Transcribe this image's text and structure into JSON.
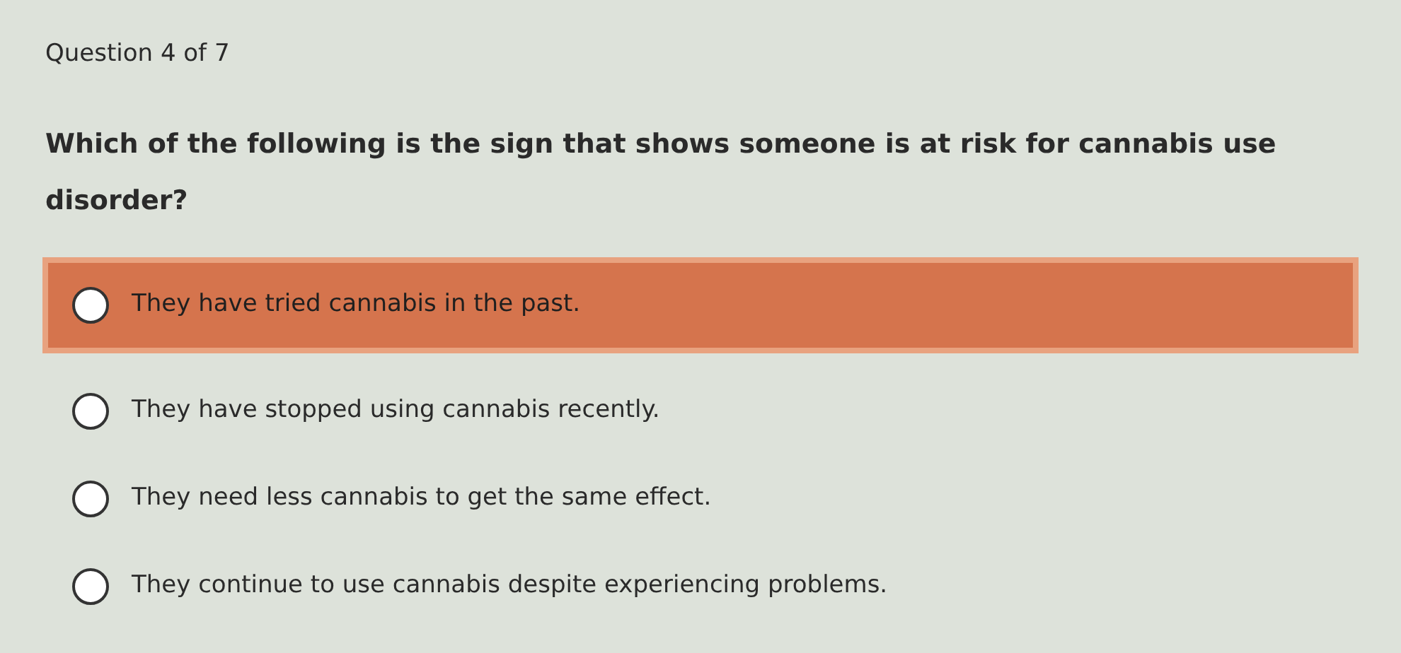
{
  "progress": "Question 4 of 7",
  "question": "Which of the following is the sign that shows someone is at risk for cannabis use disorder?",
  "options": [
    {
      "label": "They have tried cannabis in the past.",
      "selected": true
    },
    {
      "label": "They have stopped using cannabis recently.",
      "selected": false
    },
    {
      "label": "They need less cannabis to get the same effect.",
      "selected": false
    },
    {
      "label": "They continue to use cannabis despite experiencing problems.",
      "selected": false
    }
  ]
}
